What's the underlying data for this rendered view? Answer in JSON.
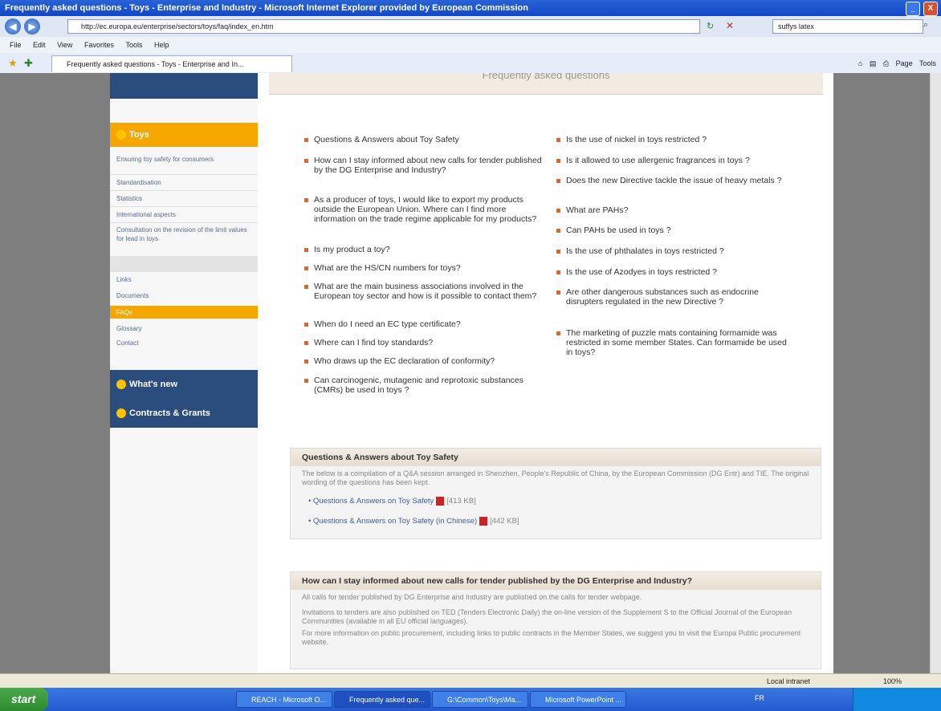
{
  "window": {
    "title": "Frequently asked questions - Toys - Enterprise and Industry - Microsoft Internet Explorer provided by European Commission",
    "minimize": "_",
    "close": "X"
  },
  "browser": {
    "url": "http://ec.europa.eu/enterprise/sectors/toys/faq/index_en.htm",
    "search_value": "suffys latex",
    "menu": [
      "File",
      "Edit",
      "View",
      "Favorites",
      "Tools",
      "Help"
    ],
    "tab_label": "Frequently asked questions - Toys - Enterprise and In...",
    "command_bar": [
      "Page",
      "Tools"
    ]
  },
  "page": {
    "heading": "Frequently asked questions",
    "sidebar": {
      "toys_heading": "Toys",
      "toys_links": [
        "Ensuring toy safety for consumers",
        "Standardisation",
        "Statistics",
        "International aspects",
        "Consultation on the revision of the limit values for lead in toys"
      ],
      "general_links": [
        "Links",
        "Documents",
        "FAQs",
        "Glossary",
        "Contact"
      ],
      "whats_new": "What's new",
      "contracts": "Contracts & Grants"
    },
    "faq_left": [
      "Questions & Answers about Toy Safety",
      "How can I stay informed about new calls for tender published by the DG Enterprise and Industry?",
      "As a producer of toys, I would like to export my products outside the European Union. Where can I find more information on the trade regime applicable for my products?",
      "Is my product a toy?",
      "What are the HS/CN numbers for toys?",
      "What are the main business associations involved in the European toy sector and how is it possible to contact them?",
      "When do I need an EC type certificate?",
      "Where can I find toy standards?",
      "Who draws up the EC declaration of conformity?",
      "Can carcinogenic, mutagenic and reprotoxic substances (CMRs) be used in toys ?"
    ],
    "faq_right": [
      "Is the use of nickel in toys restricted ?",
      "Is it allowed to use allergenic fragrances in toys ?",
      "Does the new Directive tackle the issue of heavy metals ?",
      "What are PAHs?",
      "Can PAHs be used in toys ?",
      "Is the use of phthalates in toys restricted ?",
      "Is the use of Azodyes in toys restricted ?",
      "Are other dangerous substances such as endocrine disrupters regulated in the new Directive ?",
      "The marketing of puzzle mats containing formamide was restricted in some member States. Can formamide be used in toys?"
    ],
    "section1": {
      "title": "Questions & Answers about Toy Safety",
      "text": "The below is a compilation of a Q&A session arranged in Shenzhen, People's Republic of China, by the European Commission (DG Entr) and TIE. The original wording of the questions has been kept.",
      "links": [
        {
          "label": "Questions & Answers on Toy Safety",
          "size": "[413 KB]"
        },
        {
          "label": "Questions & Answers on Toy Safety (in Chinese)",
          "size": "[442 KB]"
        }
      ]
    },
    "section2": {
      "title": "How can I stay informed about new calls for tender published by the DG Enterprise and Industry?",
      "text1": "All calls for tender published by DG Enterprise and Industry are published on the calls for tender webpage.",
      "text2": "Invitations to tenders are also published on TED (Tenders Electronic Daily) the on-line version of the Supplement S to the Official Journal of the European Communities (available in all EU official languages).",
      "text3": "For more information on public procurement, including links to public contracts in the Member States, we suggest you to visit the Europa Public procurement website."
    }
  },
  "status": {
    "zone": "Local intranet",
    "zoom": "100%"
  },
  "taskbar": {
    "start": "start",
    "items": [
      "REACH - Microsoft O...",
      "Frequently asked que...",
      "G:\\Common\\Toys\\Ma...",
      "Microsoft PowerPoint ..."
    ],
    "lang": "FR"
  }
}
